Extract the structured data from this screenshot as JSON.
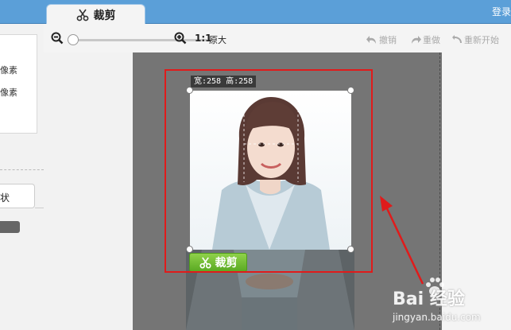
{
  "topbar": {
    "tab_label": "裁剪",
    "login_label": "登录"
  },
  "toolbar": {
    "one_to_one": "1:1",
    "original_size": "原大",
    "undo": "撤销",
    "redo": "重做",
    "restart": "重新开始",
    "zoom_percent": 0
  },
  "left_panel": {
    "list_items": [
      "像素",
      "像素"
    ],
    "tab_label": "状"
  },
  "canvas": {
    "size_label": "宽:258 高:258",
    "crop_button": "裁剪"
  },
  "watermark": {
    "brand": "Bai 经验",
    "site": "jingyan.baidu.com"
  },
  "colors": {
    "accent_blue": "#5b9fd8",
    "crop_green": "#6cbf2e",
    "annotation_red": "#e01b1b",
    "canvas_gray": "#757575"
  },
  "icons": [
    "scissors-icon",
    "zoom-out-icon",
    "zoom-in-icon",
    "undo-icon",
    "redo-icon",
    "restart-icon",
    "paw-icon"
  ]
}
